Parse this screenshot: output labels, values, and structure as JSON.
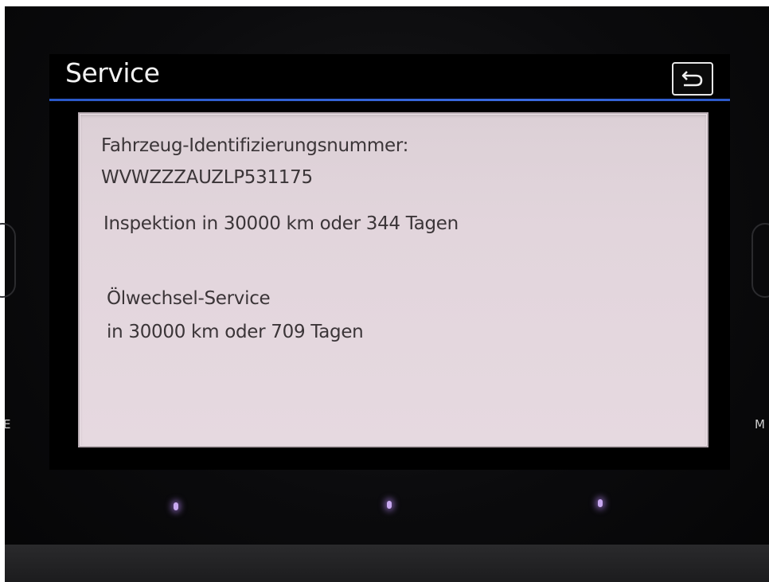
{
  "header": {
    "title": "Service"
  },
  "panel": {
    "vin_label": "Fahrzeug-Identifizierungsnummer:",
    "vin_value": "WVWZZZAUZLP531175",
    "inspection": "Inspektion in 30000 km oder 344 Tagen",
    "oil_title": "Ölwechsel-Service",
    "oil_detail": "in 30000 km oder 709 Tagen"
  },
  "bezel": {
    "left_edge_letter": "E",
    "right_edge_letter": "M"
  },
  "icons": {
    "back": "back-arrow-icon"
  },
  "colors": {
    "accent_rule": "#2a58c8",
    "panel_background": "#e2d5dc",
    "text": "#3b3538",
    "button_glow": "#c8a8f0"
  }
}
